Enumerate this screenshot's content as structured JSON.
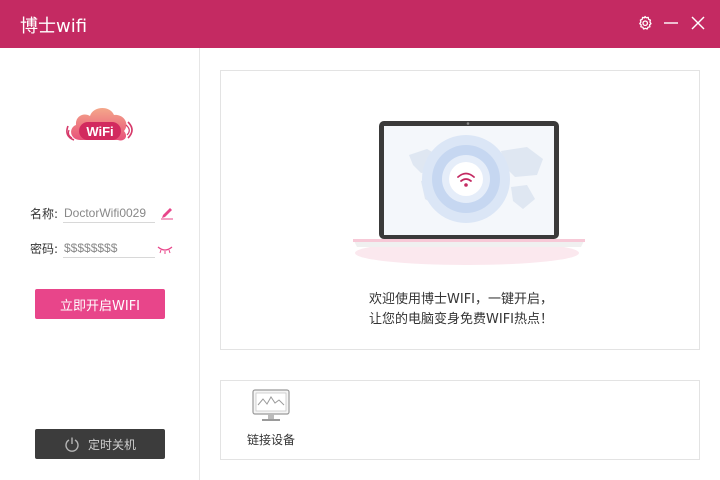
{
  "titlebar": {
    "title": "博士wifi",
    "settings_icon": "gear-icon",
    "minimize_icon": "minimize-icon",
    "close_icon": "close-icon",
    "color": "#c42a62"
  },
  "sidebar": {
    "logo_text": "WiFi",
    "name_label": "名称:",
    "name_value": "DoctorWifi0029",
    "name_edit_icon": "pencil-icon",
    "password_label": "密码:",
    "password_value": "$$$$$$$$",
    "password_toggle_icon": "eye-closed-icon",
    "start_button": "立即开启WIFI",
    "shutdown_icon": "power-icon",
    "shutdown_button": "定时关机"
  },
  "main": {
    "welcome_line1": "欢迎使用博士WIFI，一键开启，",
    "welcome_line2": "让您的电脑变身免费WIFI热点！"
  },
  "devices": {
    "icon": "monitor-icon",
    "label": "链接设备"
  },
  "colors": {
    "accent": "#e8458a",
    "brand": "#c42a62",
    "dark_button": "#3c3c3c"
  }
}
